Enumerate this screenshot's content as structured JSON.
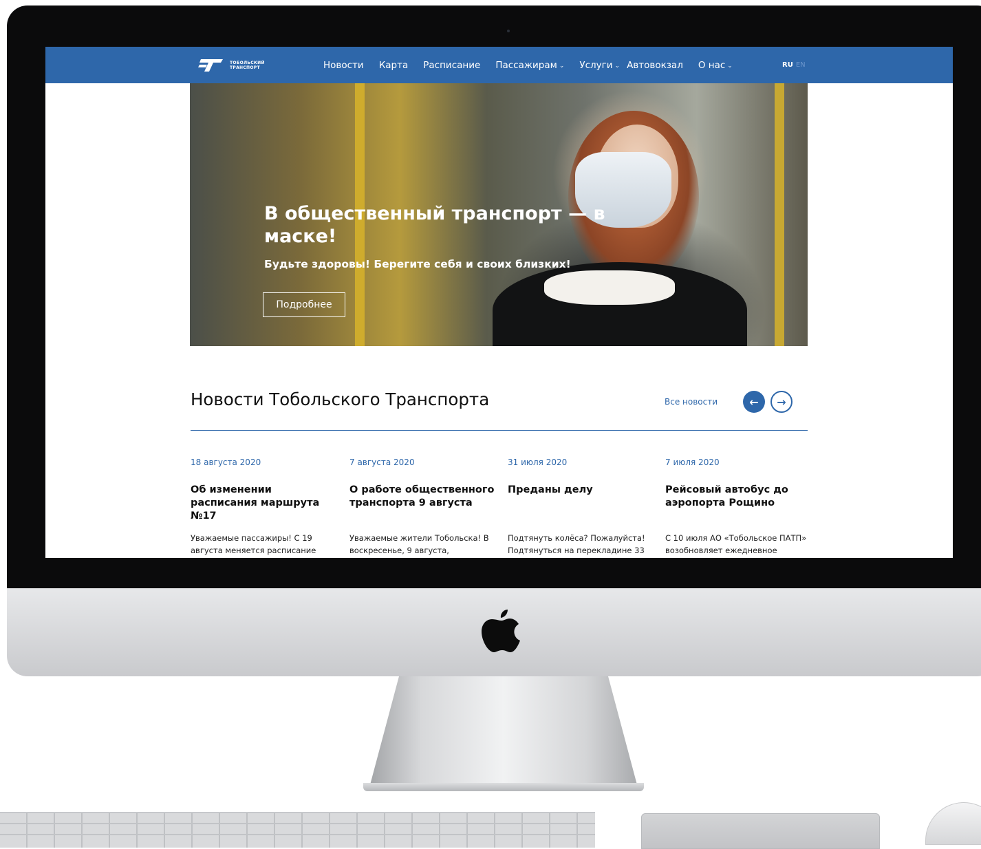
{
  "header": {
    "logo_text": "ТОБОЛЬСКИЙ ТРАНСПОРТ",
    "nav": [
      {
        "label": "Новости",
        "dropdown": false
      },
      {
        "label": "Карта",
        "dropdown": false
      },
      {
        "label": "Расписание",
        "dropdown": false
      },
      {
        "label": "Пассажирам",
        "dropdown": true
      },
      {
        "label": "Услуги",
        "dropdown": true
      },
      {
        "label": "Автовокзал",
        "dropdown": false
      },
      {
        "label": "О нас",
        "dropdown": true
      }
    ],
    "lang_active": "RU",
    "lang_inactive": "EN"
  },
  "hero": {
    "title": "В общественный транспорт — в маске!",
    "subtitle": "Будьте здоровы! Берегите себя и своих близких!",
    "button_label": "Подробнее"
  },
  "news": {
    "section_title": "Новости Тобольского Транспорта",
    "all_news_label": "Все новости",
    "prev_icon": "arrow-left-icon",
    "next_icon": "arrow-right-icon",
    "items": [
      {
        "date": "18 августа 2020",
        "headline": "Об изменении расписания маршрута №17",
        "text": "Уважаемые пассажиры! С 19 августа меняется расписание"
      },
      {
        "date": "7 августа 2020",
        "headline": "О работе общественного транспорта 9 августа",
        "text": "Уважаемые жители Тобольска! В воскресенье, 9 августа,"
      },
      {
        "date": "31 июля 2020",
        "headline": "Преданы делу",
        "text": "Подтянуть колёса? Пожалуйста! Подтянуться на перекладине 33"
      },
      {
        "date": "7 июля 2020",
        "headline": "Рейсовый автобус до аэропорта Рощино",
        "text": "С 10 июля АО «Тобольское ПАТП» возобновляет ежедневное"
      }
    ]
  },
  "colors": {
    "brand_blue": "#2e67aa",
    "bezel": "#0b0b0c"
  }
}
